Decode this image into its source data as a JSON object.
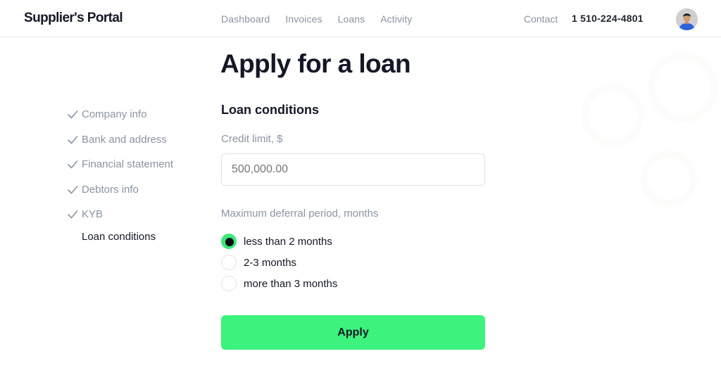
{
  "header": {
    "logo": "Supplier's Portal",
    "nav": [
      {
        "label": "Dashboard"
      },
      {
        "label": "Invoices"
      },
      {
        "label": "Loans"
      },
      {
        "label": "Activity"
      }
    ],
    "contact_label": "Contact",
    "phone": "1 510-224-4801",
    "avatar_icon": "user-avatar"
  },
  "page": {
    "title": "Apply for a loan"
  },
  "steps": [
    {
      "label": "Company info",
      "status": "done",
      "icon": "check-icon"
    },
    {
      "label": "Bank and address",
      "status": "done",
      "icon": "check-icon"
    },
    {
      "label": "Financial statement",
      "status": "done",
      "icon": "check-icon"
    },
    {
      "label": "Debtors info",
      "status": "done",
      "icon": "check-icon"
    },
    {
      "label": "KYB",
      "status": "done",
      "icon": "check-icon"
    },
    {
      "label": "Loan conditions",
      "status": "current"
    }
  ],
  "form": {
    "section_title": "Loan conditions",
    "credit_limit": {
      "label": "Credit limit, $",
      "placeholder": "500,000.00",
      "value": ""
    },
    "deferral": {
      "label": "Maximum deferral period, months",
      "options": [
        {
          "label": "less than 2 months",
          "checked": true
        },
        {
          "label": "2-3 months",
          "checked": false
        },
        {
          "label": "more than 3 months",
          "checked": false
        }
      ]
    },
    "submit_label": "Apply"
  },
  "colors": {
    "accent": "#3df27d",
    "text_primary": "#141826",
    "text_muted": "#8a94a3"
  }
}
